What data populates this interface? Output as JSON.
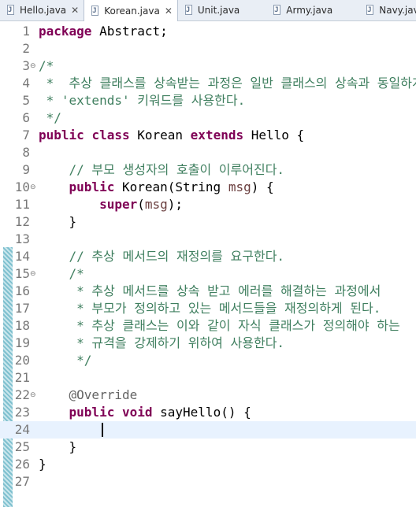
{
  "tabs": [
    {
      "label": "Hello.java",
      "active": false,
      "closable": true
    },
    {
      "label": "Korean.java",
      "active": true,
      "closable": true
    },
    {
      "label": "Unit.java",
      "active": false,
      "closable": false
    },
    {
      "label": "Army.java",
      "active": false,
      "closable": false
    },
    {
      "label": "Navy.java",
      "active": false,
      "closable": false
    }
  ],
  "tab_close_glyph": "✕",
  "fold_glyph": "⊖",
  "editor": {
    "current_line": 24,
    "lines": [
      {
        "n": "1",
        "segs": [
          {
            "t": "package",
            "c": "kw"
          },
          {
            "t": " Abstract;",
            "c": "pl"
          }
        ]
      },
      {
        "n": "2",
        "segs": []
      },
      {
        "n": "3",
        "fold": true,
        "segs": [
          {
            "t": "/*",
            "c": "cm"
          }
        ]
      },
      {
        "n": "4",
        "segs": [
          {
            "t": " *  추상 클래스를 상속받는 과정은 일반 클래스의 상속과 동일하게",
            "c": "cm"
          }
        ]
      },
      {
        "n": "5",
        "segs": [
          {
            "t": " * 'extends' 키워드를 사용한다.",
            "c": "cm"
          }
        ]
      },
      {
        "n": "6",
        "segs": [
          {
            "t": " */",
            "c": "cm"
          }
        ]
      },
      {
        "n": "7",
        "segs": [
          {
            "t": "public",
            "c": "kw"
          },
          {
            "t": " ",
            "c": "pl"
          },
          {
            "t": "class",
            "c": "kw"
          },
          {
            "t": " Korean ",
            "c": "pl"
          },
          {
            "t": "extends",
            "c": "kw"
          },
          {
            "t": " Hello {",
            "c": "pl"
          }
        ]
      },
      {
        "n": "8",
        "segs": []
      },
      {
        "n": "9",
        "segs": [
          {
            "t": "    // 부모 생성자의 호출이 이루어진다.",
            "c": "cm"
          }
        ]
      },
      {
        "n": "10",
        "fold": true,
        "segs": [
          {
            "t": "    ",
            "c": "pl"
          },
          {
            "t": "public",
            "c": "kw"
          },
          {
            "t": " Korean(String ",
            "c": "pl"
          },
          {
            "t": "msg",
            "c": "vr"
          },
          {
            "t": ") {",
            "c": "pl"
          }
        ]
      },
      {
        "n": "11",
        "segs": [
          {
            "t": "        ",
            "c": "pl"
          },
          {
            "t": "super",
            "c": "kw"
          },
          {
            "t": "(",
            "c": "pl"
          },
          {
            "t": "msg",
            "c": "vr"
          },
          {
            "t": ");",
            "c": "pl"
          }
        ]
      },
      {
        "n": "12",
        "segs": [
          {
            "t": "    }",
            "c": "pl"
          }
        ]
      },
      {
        "n": "13",
        "segs": []
      },
      {
        "n": "14",
        "segs": [
          {
            "t": "    // 추상 메서드의 재정의를 요구한다.",
            "c": "cm"
          }
        ]
      },
      {
        "n": "15",
        "fold": true,
        "segs": [
          {
            "t": "    /*",
            "c": "cm"
          }
        ]
      },
      {
        "n": "16",
        "segs": [
          {
            "t": "     * 추상 메서드를 상속 받고 에러를 해결하는 과정에서",
            "c": "cm"
          }
        ]
      },
      {
        "n": "17",
        "segs": [
          {
            "t": "     * 부모가 정의하고 있는 메서드들을 재정의하게 된다.",
            "c": "cm"
          }
        ]
      },
      {
        "n": "18",
        "segs": [
          {
            "t": "     * 추상 클래스는 이와 같이 자식 클래스가 정의해야 하는",
            "c": "cm"
          }
        ]
      },
      {
        "n": "19",
        "segs": [
          {
            "t": "     * 규격을 강제하기 위하여 사용한다.",
            "c": "cm"
          }
        ]
      },
      {
        "n": "20",
        "segs": [
          {
            "t": "     */",
            "c": "cm"
          }
        ]
      },
      {
        "n": "21",
        "segs": []
      },
      {
        "n": "22",
        "fold": true,
        "segs": [
          {
            "t": "    @Override",
            "c": "an"
          }
        ]
      },
      {
        "n": "23",
        "segs": [
          {
            "t": "    ",
            "c": "pl"
          },
          {
            "t": "public",
            "c": "kw"
          },
          {
            "t": " ",
            "c": "pl"
          },
          {
            "t": "void",
            "c": "kw"
          },
          {
            "t": " sayHello() {",
            "c": "pl"
          }
        ]
      },
      {
        "n": "24",
        "segs": []
      },
      {
        "n": "25",
        "segs": [
          {
            "t": "    }",
            "c": "pl"
          }
        ]
      },
      {
        "n": "26",
        "segs": [
          {
            "t": "}",
            "c": "pl"
          }
        ]
      },
      {
        "n": "27",
        "segs": []
      }
    ]
  }
}
